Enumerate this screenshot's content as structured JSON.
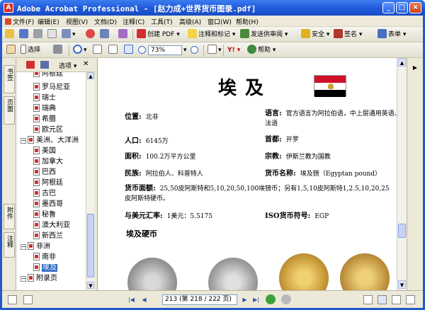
{
  "window": {
    "title": "Adobe Acrobat Professional - [赵力成+世界货币图录.pdf]"
  },
  "menu": [
    "文件(F)",
    "编辑(E)",
    "视图(V)",
    "文档(D)",
    "注释(C)",
    "工具(T)",
    "高级(A)",
    "窗口(W)",
    "帮助(H)"
  ],
  "toolbar1": {
    "create_pdf": "创建 PDF",
    "comment": "注释和标记",
    "send_review": "发送供审阅",
    "secure": "安全",
    "sign": "签名",
    "forms": "表单"
  },
  "toolbar2": {
    "select": "选择",
    "zoom": "73%",
    "help": "帮助"
  },
  "navtabs": [
    "书签",
    "页面",
    "附件",
    "注释"
  ],
  "pane": {
    "options": "选项"
  },
  "tree": [
    {
      "label": "阿根廷",
      "level": 2,
      "sel": false,
      "partial": true
    },
    {
      "label": "罗马尼亚",
      "level": 2,
      "sel": false
    },
    {
      "label": "瑞士",
      "level": 2,
      "sel": false
    },
    {
      "label": "瑞典",
      "level": 2,
      "sel": false
    },
    {
      "label": "希腊",
      "level": 2,
      "sel": false
    },
    {
      "label": "欧元区",
      "level": 2,
      "sel": false
    },
    {
      "label": "美洲、大洋洲",
      "level": 1,
      "sel": false
    },
    {
      "label": "美国",
      "level": 2,
      "sel": false
    },
    {
      "label": "加拿大",
      "level": 2,
      "sel": false
    },
    {
      "label": "巴西",
      "level": 2,
      "sel": false
    },
    {
      "label": "阿根廷",
      "level": 2,
      "sel": false
    },
    {
      "label": "古巴",
      "level": 2,
      "sel": false
    },
    {
      "label": "墨西哥",
      "level": 2,
      "sel": false
    },
    {
      "label": "秘鲁",
      "level": 2,
      "sel": false
    },
    {
      "label": "澳大利亚",
      "level": 2,
      "sel": false
    },
    {
      "label": "新西兰",
      "level": 2,
      "sel": false
    },
    {
      "label": "非洲",
      "level": 1,
      "sel": false
    },
    {
      "label": "南非",
      "level": 2,
      "sel": false
    },
    {
      "label": "埃及",
      "level": 2,
      "sel": true
    },
    {
      "label": "附录页",
      "level": 1,
      "sel": false
    }
  ],
  "doc": {
    "title": "埃及",
    "location_k": "位置:",
    "location_v": "北非",
    "language_k": "语言:",
    "language_v": "官方语言为阿拉伯语，中上层通用英语、法语",
    "population_k": "人口:",
    "population_v": "6145万",
    "capital_k": "首都:",
    "capital_v": "开罗",
    "area_k": "面积:",
    "area_v": "100.2万平方公里",
    "religion_k": "宗教:",
    "religion_v": "伊斯兰教为国教",
    "ethnic_k": "民族:",
    "ethnic_v": "阿拉伯人、科普特人",
    "currency_k": "货币名称:",
    "currency_v": "埃及镑（Egyptan pound）",
    "denom_k": "货币面额:",
    "denom_v": "25,50皮阿斯特和5,10,20,50,100埃镑币；另有1,5,10皮阿斯特1,2.5,10,20,25皮阿斯特硬币。",
    "rate_k": "与美元汇率:",
    "rate_v": "1美元：5.5175",
    "iso_k": "ISO货币符号:",
    "iso_v": "EGP",
    "coins_title": "埃及硬币"
  },
  "status": {
    "page": "213 (第 218 / 222 页)"
  },
  "colors": {
    "flag_red": "#ce1126",
    "flag_white": "#ffffff",
    "flag_black": "#000000",
    "selection": "#316ac5"
  }
}
